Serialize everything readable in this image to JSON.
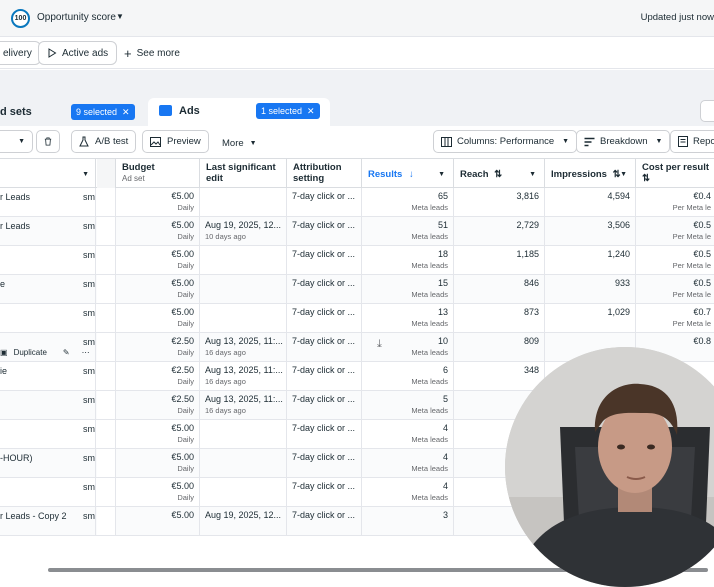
{
  "topbar": {
    "score_value": "100",
    "score_label": "Opportunity score",
    "updated": "Updated just now"
  },
  "filters": {
    "delivery": "elivery",
    "active_ads": "Active ads",
    "see_more": "See more"
  },
  "tabs": {
    "ad_sets_label": "d sets",
    "ad_sets_selected": "9 selected",
    "ads_label": "Ads",
    "ads_selected": "1 selected"
  },
  "toolbar": {
    "ab_test": "A/B test",
    "preview": "Preview",
    "more": "More",
    "columns": "Columns: Performance",
    "breakdown": "Breakdown",
    "reports": "Repo"
  },
  "columns": {
    "budget": "Budget",
    "budget_sub": "Ad set",
    "last_edit": "Last significant edit",
    "attribution": "Attribution setting",
    "results": "Results",
    "reach": "Reach",
    "impressions": "Impressions",
    "cost_per_result": "Cost per result"
  },
  "row_actions": {
    "duplicate": "Duplicate"
  },
  "rows": [
    {
      "name": "r Leads",
      "delivery": "sme",
      "budget": "€5.00",
      "budget_sub": "Daily",
      "edit": "",
      "edit_sub": "",
      "attribution": "7-day click or ...",
      "results": "65",
      "results_sub": "Meta leads",
      "reach": "3,816",
      "impressions": "4,594",
      "cpr": "€0.4",
      "cpr_sub": "Per Meta le"
    },
    {
      "name": "r Leads",
      "delivery": "sme",
      "budget": "€5.00",
      "budget_sub": "Daily",
      "edit": "Aug 19, 2025, 12...",
      "edit_sub": "10 days ago",
      "attribution": "7-day click or ...",
      "results": "51",
      "results_sub": "Meta leads",
      "reach": "2,729",
      "impressions": "3,506",
      "cpr": "€0.5",
      "cpr_sub": "Per Meta le"
    },
    {
      "name": "",
      "delivery": "sme",
      "budget": "€5.00",
      "budget_sub": "Daily",
      "edit": "",
      "edit_sub": "",
      "attribution": "7-day click or ...",
      "results": "18",
      "results_sub": "Meta leads",
      "reach": "1,185",
      "impressions": "1,240",
      "cpr": "€0.5",
      "cpr_sub": "Per Meta le"
    },
    {
      "name": "e",
      "delivery": "sme",
      "budget": "€5.00",
      "budget_sub": "Daily",
      "edit": "",
      "edit_sub": "",
      "attribution": "7-day click or ...",
      "results": "15",
      "results_sub": "Meta leads",
      "reach": "846",
      "impressions": "933",
      "cpr": "€0.5",
      "cpr_sub": "Per Meta le"
    },
    {
      "name": "",
      "delivery": "sme",
      "budget": "€5.00",
      "budget_sub": "Daily",
      "edit": "",
      "edit_sub": "",
      "attribution": "7-day click or ...",
      "results": "13",
      "results_sub": "Meta leads",
      "reach": "873",
      "impressions": "1,029",
      "cpr": "€0.7",
      "cpr_sub": "Per Meta le"
    },
    {
      "name": "",
      "delivery": "sme",
      "budget": "€2.50",
      "budget_sub": "Daily",
      "edit": "Aug 13, 2025, 11:...",
      "edit_sub": "16 days ago",
      "attribution": "7-day click or ...",
      "results": "10",
      "results_sub": "Meta leads",
      "reach": "809",
      "impressions": "",
      "cpr": "€0.8",
      "cpr_sub": ""
    },
    {
      "name": "ie",
      "delivery": "sme",
      "budget": "€2.50",
      "budget_sub": "Daily",
      "edit": "Aug 13, 2025, 11:...",
      "edit_sub": "16 days ago",
      "attribution": "7-day click or ...",
      "results": "6",
      "results_sub": "Meta leads",
      "reach": "348",
      "impressions": "",
      "cpr": "",
      "cpr_sub": ""
    },
    {
      "name": "",
      "delivery": "sme",
      "budget": "€2.50",
      "budget_sub": "Daily",
      "edit": "Aug 13, 2025, 11:...",
      "edit_sub": "16 days ago",
      "attribution": "7-day click or ...",
      "results": "5",
      "results_sub": "Meta leads",
      "reach": "",
      "impressions": "",
      "cpr": "",
      "cpr_sub": ""
    },
    {
      "name": "",
      "delivery": "sme",
      "budget": "€5.00",
      "budget_sub": "Daily",
      "edit": "",
      "edit_sub": "",
      "attribution": "7-day click or ...",
      "results": "4",
      "results_sub": "Meta leads",
      "reach": "",
      "impressions": "",
      "cpr": "",
      "cpr_sub": ""
    },
    {
      "name": "-HOUR)",
      "delivery": "sme",
      "budget": "€5.00",
      "budget_sub": "Daily",
      "edit": "",
      "edit_sub": "",
      "attribution": "7-day click or ...",
      "results": "4",
      "results_sub": "Meta leads",
      "reach": "",
      "impressions": "",
      "cpr": "",
      "cpr_sub": ""
    },
    {
      "name": "",
      "delivery": "sme",
      "budget": "€5.00",
      "budget_sub": "Daily",
      "edit": "",
      "edit_sub": "",
      "attribution": "7-day click or ...",
      "results": "4",
      "results_sub": "Meta leads",
      "reach": "",
      "impressions": "",
      "cpr": "",
      "cpr_sub": ""
    },
    {
      "name": "r Leads - Copy 2",
      "delivery": "sme",
      "budget": "€5.00",
      "budget_sub": "",
      "edit": "Aug 19, 2025, 12...",
      "edit_sub": "",
      "attribution": "7-day click or ...",
      "results": "3",
      "results_sub": "",
      "reach": "",
      "impressions": "",
      "cpr": "",
      "cpr_sub": ""
    }
  ],
  "colors": {
    "accent": "#1877f2",
    "results_header": "#1877f2"
  }
}
